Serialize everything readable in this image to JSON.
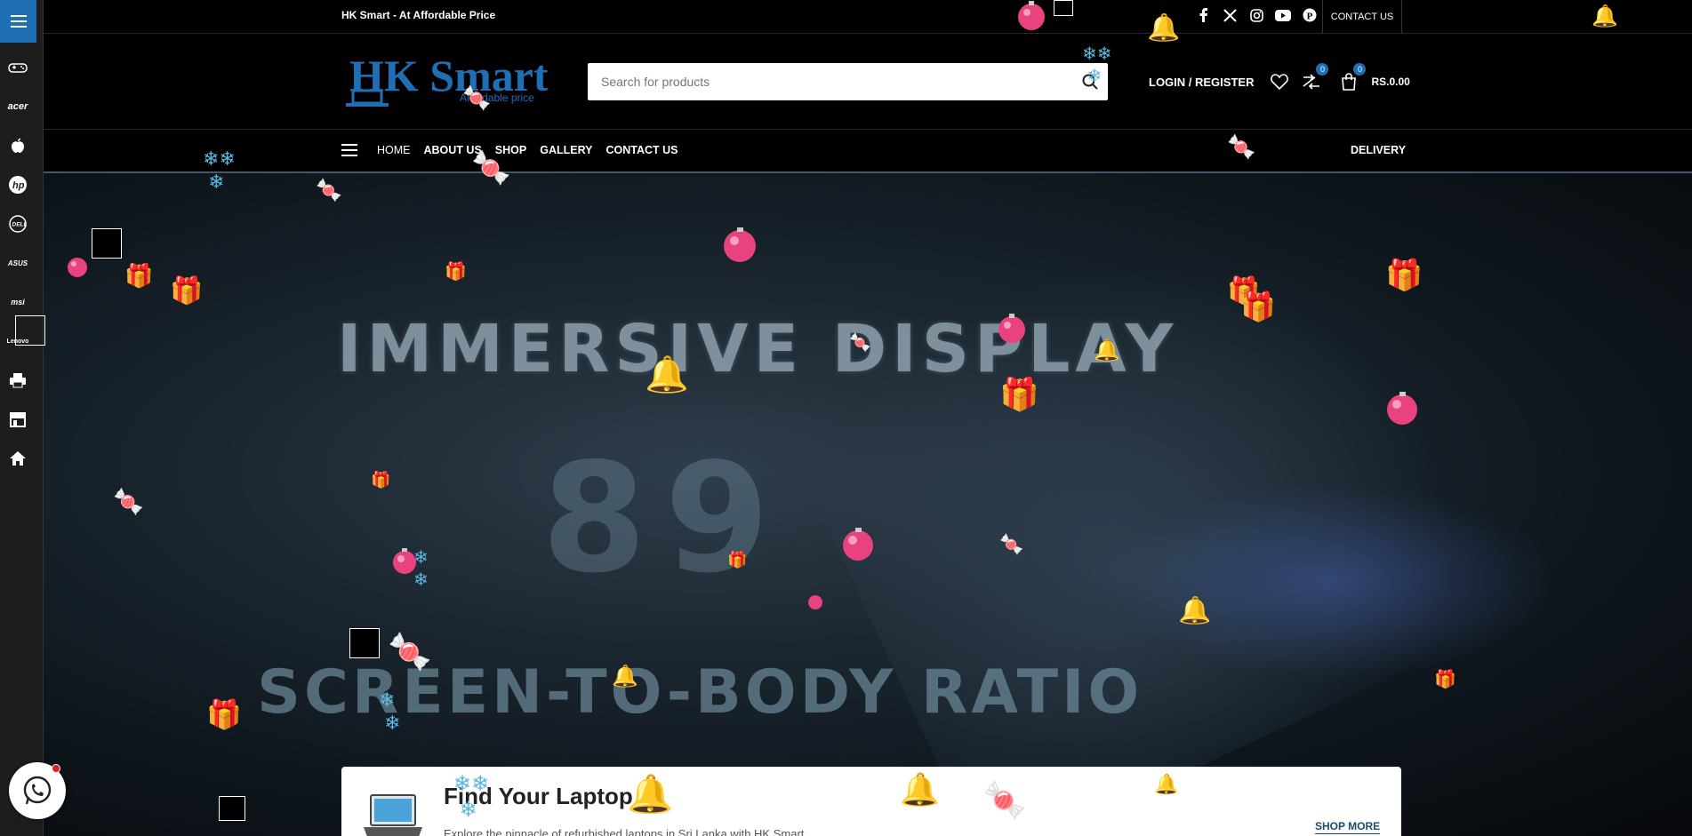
{
  "topbar": {
    "tagline": "HK Smart - At Affordable Price",
    "contact_label": "CONTACT US",
    "socials": [
      "facebook-icon",
      "x-twitter-icon",
      "instagram-icon",
      "youtube-icon",
      "pinterest-icon"
    ]
  },
  "header": {
    "logo_text": "HK Smart",
    "logo_subtext": "Affordable price",
    "search_placeholder": "Search for products",
    "login_label": "LOGIN / REGISTER",
    "compare_count": "0",
    "cart_count": "0",
    "cart_total": "RS.0.00"
  },
  "nav": {
    "items": [
      "HOME",
      "ABOUT US",
      "SHOP",
      "GALLERY",
      "CONTACT US"
    ],
    "delivery_label": "DELIVERY"
  },
  "sidebar": {
    "items": [
      "gamepad-icon",
      "acer-icon",
      "apple-icon",
      "hp-icon",
      "dell-icon",
      "asus-icon",
      "msi-icon",
      "lenovo-icon",
      "printer-icon",
      "store-icon",
      "home-icon"
    ],
    "labels": {
      "acer": "acer",
      "asus": "ASUS",
      "msi": "msi",
      "lenovo": "Lenovo"
    }
  },
  "hero": {
    "headline": "IMMERSIVE DISPLAY",
    "big_text": "89",
    "subline": "SCREEN-TO-BODY RATIO"
  },
  "card": {
    "title": "Find Your Laptop",
    "description": "Explore the pinnacle of refurbished laptops in Sri Lanka with HK Smart",
    "shop_more": "SHOP MORE"
  },
  "colors": {
    "accent": "#1f6fb5",
    "background": "#000000",
    "whatsapp": "#25d366"
  }
}
